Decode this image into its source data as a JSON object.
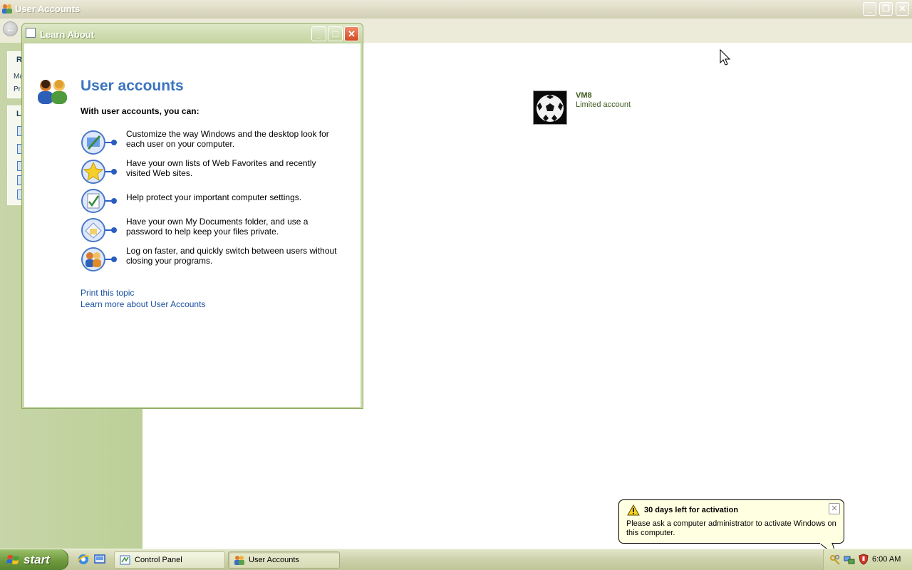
{
  "main_window": {
    "title": "User Accounts",
    "controls": [
      "minimize",
      "maximize",
      "close"
    ]
  },
  "left_pane": {
    "related_header_partial": "R",
    "related_lines_partial": [
      "Ma",
      "Pr"
    ],
    "learn_header_partial": "Le"
  },
  "account": {
    "name": "VM8",
    "type": "Limited account",
    "picture": "soccer-ball"
  },
  "learn_window": {
    "title": "Learn About",
    "heading": "User accounts",
    "subheading": "With user accounts, you can:",
    "bullets": [
      {
        "icon": "desktop-customize-icon",
        "text": "Customize the way Windows and the desktop look for each user on your computer."
      },
      {
        "icon": "favorites-star-icon",
        "text": "Have your own lists of Web Favorites and recently visited Web sites."
      },
      {
        "icon": "settings-protect-icon",
        "text": "Help protect your important computer settings."
      },
      {
        "icon": "my-documents-icon",
        "text": "Have your own My Documents folder, and use a password to help keep your files private."
      },
      {
        "icon": "switch-users-icon",
        "text": "Log on faster, and quickly switch between users without closing your programs."
      }
    ],
    "links": {
      "print": "Print this topic",
      "learn_more": "Learn more about User Accounts"
    }
  },
  "balloon": {
    "title": "30 days left for activation",
    "message": "Please ask a computer administrator to activate Windows on this computer."
  },
  "taskbar": {
    "start_label": "start",
    "quick_launch": [
      "internet-explorer-icon",
      "show-desktop-icon"
    ],
    "tasks": [
      {
        "label": "Control Panel",
        "icon": "control-panel-icon",
        "active": false
      },
      {
        "label": "User Accounts",
        "icon": "user-accounts-icon",
        "active": true
      }
    ],
    "tray_icons": [
      "activation-keys-icon",
      "network-icon",
      "security-center-shield-icon"
    ],
    "clock": "6:00 AM"
  },
  "colors": {
    "title_green": "#c8d8a8",
    "heading_blue": "#3a74c0",
    "link_blue": "#1b4f9e",
    "balloon_bg": "#ffffe1",
    "left_pane": "#c0d29e"
  }
}
